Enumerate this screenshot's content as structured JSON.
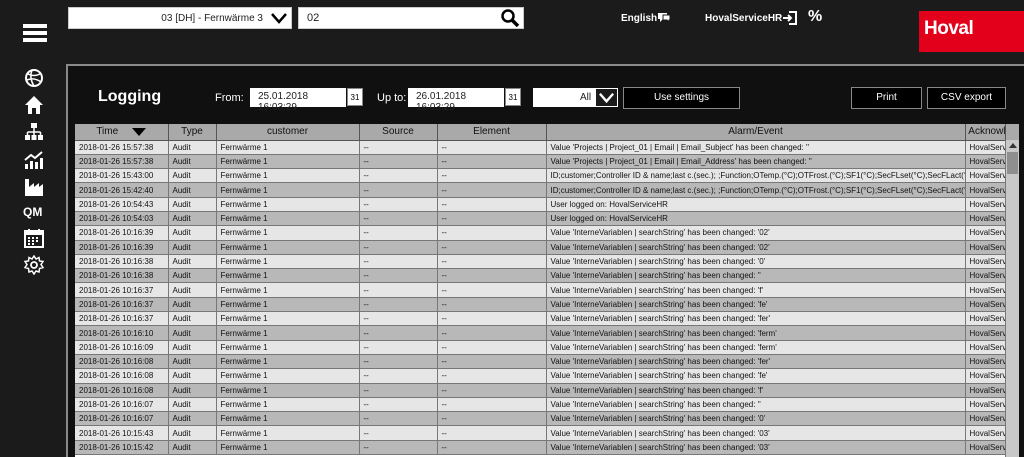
{
  "topbar": {
    "plant_select": "03 [DH] - Fernwärme 3",
    "search_value": "02",
    "language": "English",
    "user": "HovalServiceHR",
    "logo": "Hoval"
  },
  "nav": {
    "qm_label": "QM"
  },
  "logging": {
    "title": "Logging",
    "from_label": "From:",
    "from_value": "25.01.2018 16:03:29",
    "upto_label": "Up to:",
    "upto_value": "26.01.2018 16:03:29",
    "calendar_glyph": "31",
    "filter_value": "All",
    "use_settings_label": "Use settings",
    "print_label": "Print",
    "csv_label": "CSV export"
  },
  "table": {
    "columns": [
      "Time",
      "Type",
      "customer",
      "Source",
      "Element",
      "Alarm/Event",
      "Acknowledged by"
    ],
    "rows": [
      [
        "2018-01-26 15:57:38",
        "Audit",
        "Fernwärme 1",
        "--",
        "--",
        "Value 'Projects | Project_01 | Email | Email_Subject' has been changed: ''",
        "HovalServiceHR"
      ],
      [
        "2018-01-26 15:57:38",
        "Audit",
        "Fernwärme 1",
        "--",
        "--",
        "Value 'Projects | Project_01 | Email | Email_Address' has been changed: ''",
        "HovalServiceHR"
      ],
      [
        "2018-01-26 15:43:00",
        "Audit",
        "Fernwärme 1",
        "--",
        "--",
        "ID;customer;Controller ID & name;last c.(sec.); ;Function;OTemp.(°C);OTFrost.(°C);SF1(°C);SecFLset(°C);SecFLact(°C);",
        "HovalServiceHR"
      ],
      [
        "2018-01-26 15:42:40",
        "Audit",
        "Fernwärme 1",
        "--",
        "--",
        "ID;customer;Controller ID & name;last c.(sec.); ;Function;OTemp.(°C);OTFrost.(°C);SF1(°C);SecFLset(°C);SecFLact(°C);",
        "HovalServiceHR"
      ],
      [
        "2018-01-26 10:54:43",
        "Audit",
        "Fernwärme 1",
        "--",
        "--",
        "User logged on: HovalServiceHR",
        "HovalServiceHR"
      ],
      [
        "2018-01-26 10:54:03",
        "Audit",
        "Fernwärme 1",
        "--",
        "--",
        "User logged on: HovalServiceHR",
        "HovalServiceHR"
      ],
      [
        "2018-01-26 10:16:39",
        "Audit",
        "Fernwärme 1",
        "--",
        "--",
        "Value 'InterneVariablen | searchString' has been changed: '02'",
        "HovalServiceHR"
      ],
      [
        "2018-01-26 10:16:39",
        "Audit",
        "Fernwärme 1",
        "--",
        "--",
        "Value 'InterneVariablen | searchString' has been changed: '02'",
        "HovalServiceHR"
      ],
      [
        "2018-01-26 10:16:38",
        "Audit",
        "Fernwärme 1",
        "--",
        "--",
        "Value 'InterneVariablen | searchString' has been changed: '0'",
        "HovalServiceHR"
      ],
      [
        "2018-01-26 10:16:38",
        "Audit",
        "Fernwärme 1",
        "--",
        "--",
        "Value 'InterneVariablen | searchString' has been changed: ''",
        "HovalServiceHR"
      ],
      [
        "2018-01-26 10:16:37",
        "Audit",
        "Fernwärme 1",
        "--",
        "--",
        "Value 'InterneVariablen | searchString' has been changed: 'f'",
        "HovalServiceHR"
      ],
      [
        "2018-01-26 10:16:37",
        "Audit",
        "Fernwärme 1",
        "--",
        "--",
        "Value 'InterneVariablen | searchString' has been changed: 'fe'",
        "HovalServiceHR"
      ],
      [
        "2018-01-26 10:16:37",
        "Audit",
        "Fernwärme 1",
        "--",
        "--",
        "Value 'InterneVariablen | searchString' has been changed: 'fer'",
        "HovalServiceHR"
      ],
      [
        "2018-01-26 10:16:10",
        "Audit",
        "Fernwärme 1",
        "--",
        "--",
        "Value 'InterneVariablen | searchString' has been changed: 'ferm'",
        "HovalServiceHR"
      ],
      [
        "2018-01-26 10:16:09",
        "Audit",
        "Fernwärme 1",
        "--",
        "--",
        "Value 'InterneVariablen | searchString' has been changed: 'ferm'",
        "HovalServiceHR"
      ],
      [
        "2018-01-26 10:16:08",
        "Audit",
        "Fernwärme 1",
        "--",
        "--",
        "Value 'InterneVariablen | searchString' has been changed: 'fer'",
        "HovalServiceHR"
      ],
      [
        "2018-01-26 10:16:08",
        "Audit",
        "Fernwärme 1",
        "--",
        "--",
        "Value 'InterneVariablen | searchString' has been changed: 'fe'",
        "HovalServiceHR"
      ],
      [
        "2018-01-26 10:16:08",
        "Audit",
        "Fernwärme 1",
        "--",
        "--",
        "Value 'InterneVariablen | searchString' has been changed: 'f'",
        "HovalServiceHR"
      ],
      [
        "2018-01-26 10:16:07",
        "Audit",
        "Fernwärme 1",
        "--",
        "--",
        "Value 'InterneVariablen | searchString' has been changed: ''",
        "HovalServiceHR"
      ],
      [
        "2018-01-26 10:16:07",
        "Audit",
        "Fernwärme 1",
        "--",
        "--",
        "Value 'InterneVariablen | searchString' has been changed: '0'",
        "HovalServiceHR"
      ],
      [
        "2018-01-26 10:15:43",
        "Audit",
        "Fernwärme 1",
        "--",
        "--",
        "Value 'InterneVariablen | searchString' has been changed: '03'",
        "HovalServiceHR"
      ],
      [
        "2018-01-26 10:15:42",
        "Audit",
        "Fernwärme 1",
        "--",
        "--",
        "Value 'InterneVariablen | searchString' has been changed: '03'",
        "HovalServiceHR"
      ]
    ]
  }
}
